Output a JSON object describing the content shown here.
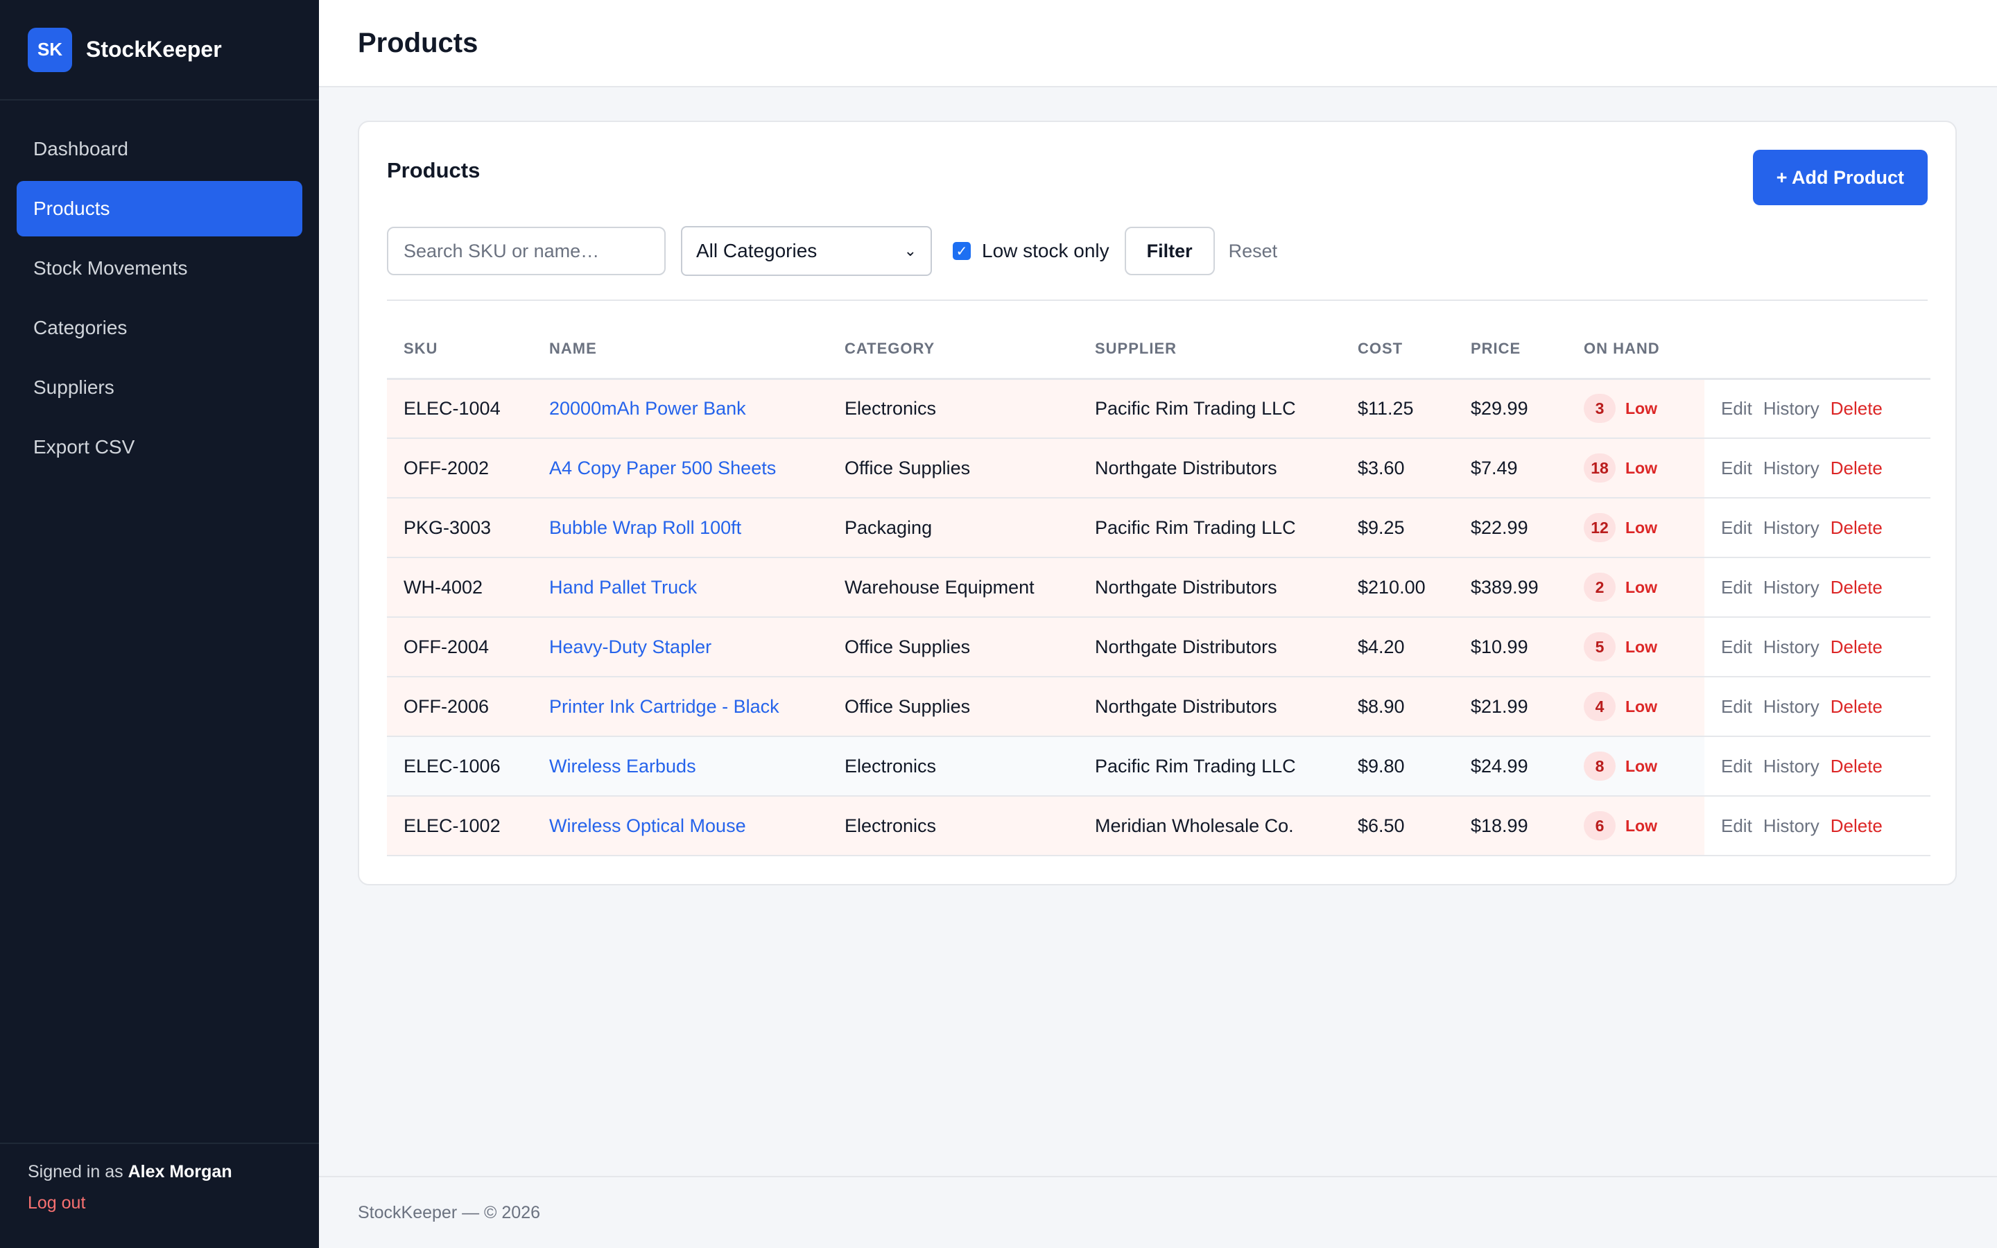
{
  "brand": {
    "logo": "SK",
    "name": "StockKeeper"
  },
  "nav": [
    {
      "label": "Dashboard",
      "active": false
    },
    {
      "label": "Products",
      "active": true
    },
    {
      "label": "Stock Movements",
      "active": false
    },
    {
      "label": "Categories",
      "active": false
    },
    {
      "label": "Suppliers",
      "active": false
    },
    {
      "label": "Export CSV",
      "active": false
    }
  ],
  "user": {
    "prefix": "Signed in as",
    "name": "Alex Morgan",
    "logout": "Log out"
  },
  "header": {
    "title": "Products"
  },
  "card": {
    "title": "Products",
    "add_label": "+ Add Product"
  },
  "filters": {
    "search_placeholder": "Search SKU or name…",
    "category_selected": "All Categories",
    "low_stock_label": "Low stock only",
    "low_stock_checked": true,
    "filter_label": "Filter",
    "reset_label": "Reset"
  },
  "table": {
    "columns": [
      "SKU",
      "NAME",
      "CATEGORY",
      "SUPPLIER",
      "COST",
      "PRICE",
      "ON HAND"
    ],
    "low_label": "Low",
    "actions": {
      "edit": "Edit",
      "history": "History",
      "delete": "Delete"
    },
    "rows": [
      {
        "sku": "ELEC-1004",
        "name": "20000mAh Power Bank",
        "category": "Electronics",
        "supplier": "Pacific Rim Trading LLC",
        "cost": "$11.25",
        "price": "$29.99",
        "on_hand": "3",
        "shade": "low"
      },
      {
        "sku": "OFF-2002",
        "name": "A4 Copy Paper 500 Sheets",
        "category": "Office Supplies",
        "supplier": "Northgate Distributors",
        "cost": "$3.60",
        "price": "$7.49",
        "on_hand": "18",
        "shade": "low"
      },
      {
        "sku": "PKG-3003",
        "name": "Bubble Wrap Roll 100ft",
        "category": "Packaging",
        "supplier": "Pacific Rim Trading LLC",
        "cost": "$9.25",
        "price": "$22.99",
        "on_hand": "12",
        "shade": "low"
      },
      {
        "sku": "WH-4002",
        "name": "Hand Pallet Truck",
        "category": "Warehouse Equipment",
        "supplier": "Northgate Distributors",
        "cost": "$210.00",
        "price": "$389.99",
        "on_hand": "2",
        "shade": "low"
      },
      {
        "sku": "OFF-2004",
        "name": "Heavy-Duty Stapler",
        "category": "Office Supplies",
        "supplier": "Northgate Distributors",
        "cost": "$4.20",
        "price": "$10.99",
        "on_hand": "5",
        "shade": "low"
      },
      {
        "sku": "OFF-2006",
        "name": "Printer Ink Cartridge - Black",
        "category": "Office Supplies",
        "supplier": "Northgate Distributors",
        "cost": "$8.90",
        "price": "$21.99",
        "on_hand": "4",
        "shade": "low"
      },
      {
        "sku": "ELEC-1006",
        "name": "Wireless Earbuds",
        "category": "Electronics",
        "supplier": "Pacific Rim Trading LLC",
        "cost": "$9.80",
        "price": "$24.99",
        "on_hand": "8",
        "shade": "normal"
      },
      {
        "sku": "ELEC-1002",
        "name": "Wireless Optical Mouse",
        "category": "Electronics",
        "supplier": "Meridian Wholesale Co.",
        "cost": "$6.50",
        "price": "$18.99",
        "on_hand": "6",
        "shade": "low"
      }
    ]
  },
  "footer": {
    "text": "StockKeeper — © 2026"
  },
  "colors": {
    "accent": "#2563eb",
    "sidebar": "#111827",
    "danger": "#dc2626",
    "low_row": "#fff5f3"
  },
  "icons": {
    "select_chevron": "chevron-down-icon",
    "checkbox": "check-icon"
  }
}
